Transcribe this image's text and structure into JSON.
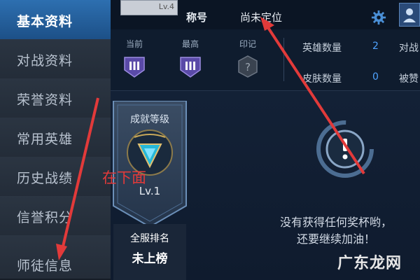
{
  "sidebar": {
    "items": [
      {
        "label": "基本资料",
        "active": true
      },
      {
        "label": "对战资料",
        "active": false
      },
      {
        "label": "荣誉资料",
        "active": false
      },
      {
        "label": "常用英雄",
        "active": false
      },
      {
        "label": "历史战绩",
        "active": false
      },
      {
        "label": "信誉积分",
        "active": false
      },
      {
        "label": "师徒信息",
        "active": false
      }
    ]
  },
  "header": {
    "avatar_level": "Lv.4",
    "title_label": "称号",
    "title_value": "尚未定位"
  },
  "stats": {
    "current_label": "当前",
    "highest_label": "最高",
    "mark_label": "印记",
    "hero_count_label": "英雄数量",
    "hero_count_value": "2",
    "skin_count_label": "皮肤数量",
    "skin_count_value": "0",
    "right_label_1": "对战",
    "right_label_2": "被赞"
  },
  "achievement": {
    "title": "成就等级",
    "level": "Lv.1",
    "rank_label": "全服排名",
    "rank_value": "未上榜"
  },
  "empty_state": {
    "line1": "没有获得任何奖杯哟，",
    "line2": "还要继续加油！"
  },
  "annotation": {
    "text": "在下面"
  },
  "watermark": {
    "text": "广东龙网"
  },
  "colors": {
    "accent": "#2d6fb0",
    "value_blue": "#4fa3ff",
    "arrow_red": "#e23a3a"
  }
}
